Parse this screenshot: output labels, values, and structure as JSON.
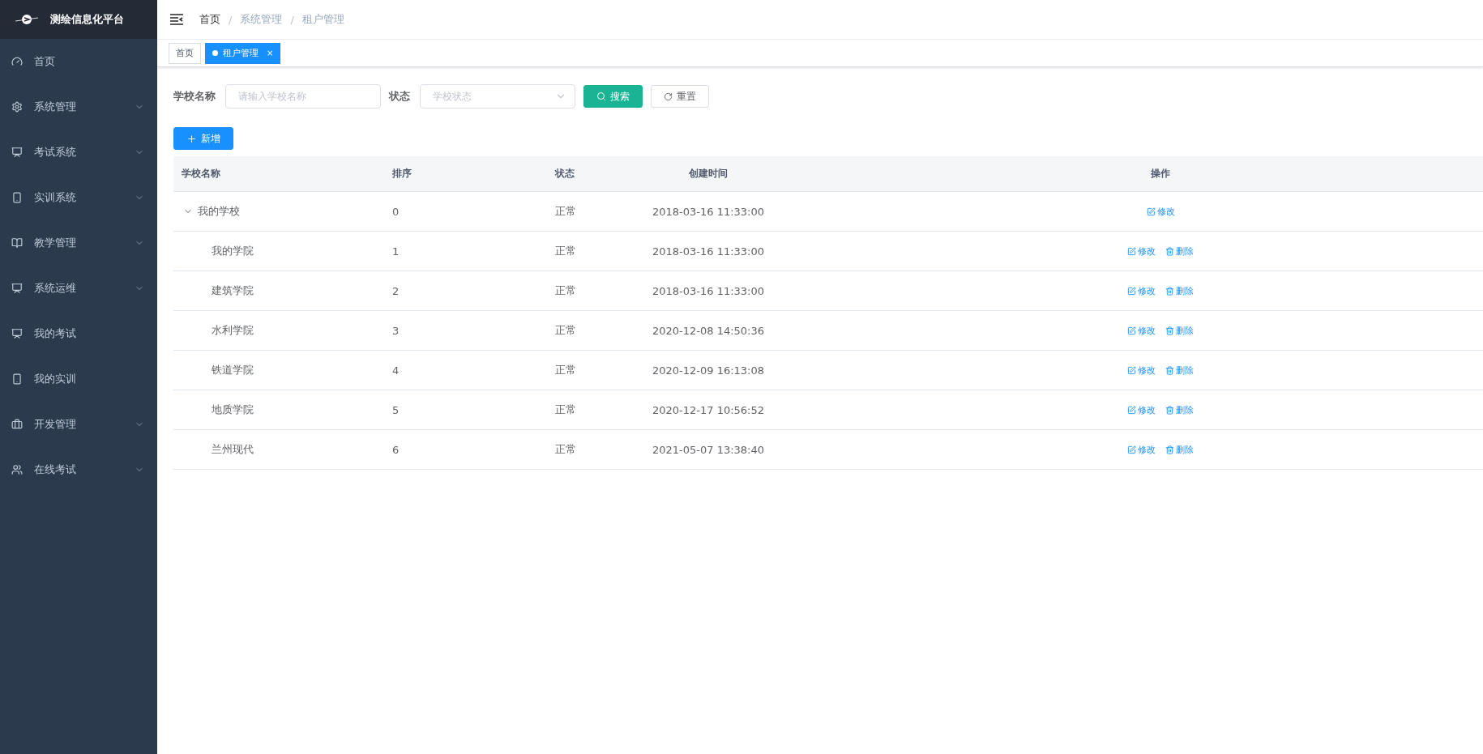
{
  "brand": {
    "title": "测绘信息化平台"
  },
  "sidebar": {
    "items": [
      {
        "label": "首页",
        "expandable": false
      },
      {
        "label": "系统管理",
        "expandable": true
      },
      {
        "label": "考试系统",
        "expandable": true
      },
      {
        "label": "实训系统",
        "expandable": true
      },
      {
        "label": "教学管理",
        "expandable": true
      },
      {
        "label": "系统运维",
        "expandable": true
      },
      {
        "label": "我的考试",
        "expandable": false
      },
      {
        "label": "我的实训",
        "expandable": false
      },
      {
        "label": "开发管理",
        "expandable": true
      },
      {
        "label": "在线考试",
        "expandable": true
      }
    ]
  },
  "breadcrumb": [
    {
      "label": "首页",
      "current": false
    },
    {
      "label": "系统管理",
      "current": true
    },
    {
      "label": "租户管理",
      "current": true
    }
  ],
  "breadcrumb_separator": "/",
  "tabs": [
    {
      "label": "首页",
      "selected": false
    },
    {
      "label": "租户管理",
      "selected": true,
      "close": "×"
    }
  ],
  "filters": {
    "name_label": "学校名称",
    "name_placeholder": "请输入学校名称",
    "status_label": "状态",
    "status_placeholder": "学校状态",
    "search_button": "搜索",
    "reset_button": "重置"
  },
  "add_button": "新增",
  "table": {
    "columns": [
      "学校名称",
      "排序",
      "状态",
      "创建时间",
      "操作"
    ],
    "rows": [
      {
        "name": "我的学校",
        "sort": "0",
        "status": "正常",
        "created": "2018-03-16 11:33:00",
        "actions": [
          "修改"
        ],
        "expanded": true,
        "children": [
          {
            "name": "我的学院",
            "sort": "1",
            "status": "正常",
            "created": "2018-03-16 11:33:00",
            "actions": [
              "修改",
              "删除"
            ]
          },
          {
            "name": "建筑学院",
            "sort": "2",
            "status": "正常",
            "created": "2018-03-16 11:33:00",
            "actions": [
              "修改",
              "删除"
            ]
          },
          {
            "name": "水利学院",
            "sort": "3",
            "status": "正常",
            "created": "2020-12-08 14:50:36",
            "actions": [
              "修改",
              "删除"
            ]
          },
          {
            "name": "铁道学院",
            "sort": "4",
            "status": "正常",
            "created": "2020-12-09 16:13:08",
            "actions": [
              "修改",
              "删除"
            ]
          },
          {
            "name": "地质学院",
            "sort": "5",
            "status": "正常",
            "created": "2020-12-17 10:56:52",
            "actions": [
              "修改",
              "删除"
            ]
          },
          {
            "name": "兰州现代",
            "sort": "6",
            "status": "正常",
            "created": "2021-05-07 13:38:40",
            "actions": [
              "修改",
              "删除"
            ]
          }
        ]
      }
    ]
  }
}
